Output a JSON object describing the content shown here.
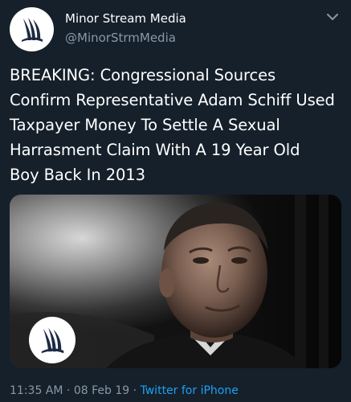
{
  "author": {
    "display_name": "Minor Stream Media",
    "handle": "@MinorStrmMedia",
    "avatar_icon": "wave-logo-icon"
  },
  "tweet": {
    "lines": [
      "BREAKING: Congressional Sources",
      "Confirm Representative Adam Schiff Used",
      "Taxpayer Money To Settle A Sexual",
      "Harrasment Claim With A 19 Year Old",
      "Boy Back In 2013"
    ]
  },
  "media": {
    "watermark_icon": "wave-logo-icon"
  },
  "meta": {
    "time": "11:35 AM",
    "sep1": " · ",
    "date": "08 Feb 19",
    "sep2": " · ",
    "source": "Twitter for iPhone"
  },
  "colors": {
    "background": "#15202b",
    "text": "#ffffff",
    "muted": "#8899a6",
    "link": "#1da1f2",
    "logo": "#1d2a44"
  }
}
